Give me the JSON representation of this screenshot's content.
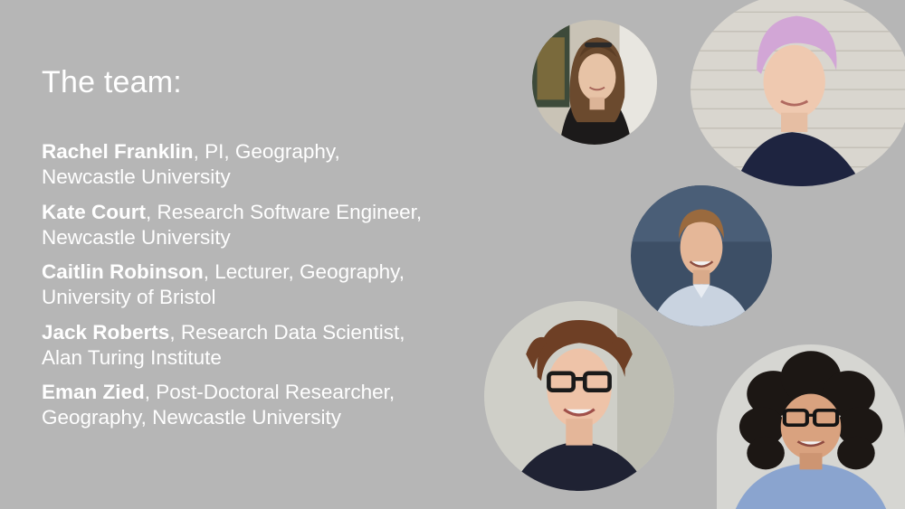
{
  "slide": {
    "title": "The team:",
    "members": [
      {
        "name": "Rachel Franklin",
        "rest": ", PI, Geography,",
        "line2": "Newcastle University"
      },
      {
        "name": "Kate Court",
        "rest": ", Research Software Engineer,",
        "line2": "Newcastle University"
      },
      {
        "name": "Caitlin Robinson",
        "rest": ", Lecturer, Geography,",
        "line2": "University of Bristol"
      },
      {
        "name": "Jack Roberts",
        "rest": ", Research Data Scientist,",
        "line2": "Alan Turing Institute"
      },
      {
        "name": "Eman Zied",
        "rest": ", Post-Doctoral Researcher,",
        "line2": "Geography, Newcastle University"
      }
    ]
  },
  "colors": {
    "background": "#b6b6b6",
    "text": "#ffffff"
  }
}
